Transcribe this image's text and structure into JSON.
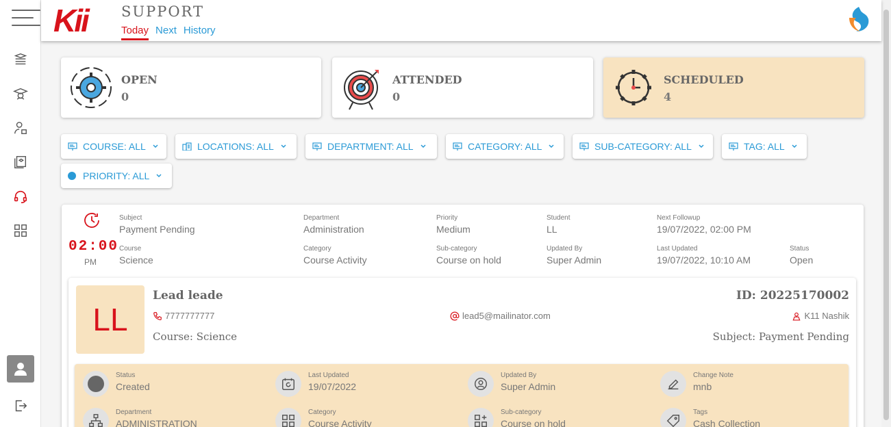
{
  "header": {
    "logo_text": "Kii",
    "title": "SUPPORT",
    "tabs": [
      {
        "label": "Today",
        "active": true
      },
      {
        "label": "Next",
        "active": false
      },
      {
        "label": "History",
        "active": false
      }
    ]
  },
  "sidebar": {
    "icons": [
      "courses-icon",
      "graduation-icon",
      "user-lock-icon",
      "library-icon",
      "headset-icon",
      "dashboard-icon"
    ],
    "active": "headset-icon",
    "profile_icon": "user-icon",
    "logout_icon": "logout-icon"
  },
  "summary": [
    {
      "label": "OPEN",
      "value": "0",
      "icon": "gear-cycle-icon"
    },
    {
      "label": "ATTENDED",
      "value": "0",
      "icon": "target-icon"
    },
    {
      "label": "SCHEDULED",
      "value": "4",
      "icon": "clock-gear-icon"
    }
  ],
  "filters": [
    {
      "label": "COURSE: ALL",
      "icon": "presentation-icon"
    },
    {
      "label": "LOCATIONS: ALL",
      "icon": "building-icon"
    },
    {
      "label": "DEPARTMENT: ALL",
      "icon": "presentation-icon"
    },
    {
      "label": "CATEGORY: ALL",
      "icon": "presentation-icon"
    },
    {
      "label": "SUB-CATEGORY: ALL",
      "icon": "presentation-icon"
    },
    {
      "label": "TAG: ALL",
      "icon": "presentation-icon"
    },
    {
      "label": "PRIORITY: ALL",
      "icon": "dot-icon"
    }
  ],
  "ticket": {
    "time": "02:00",
    "ampm": "PM",
    "fields": [
      {
        "label": "Subject",
        "value": "Payment Pending"
      },
      {
        "label": "Department",
        "value": "Administration"
      },
      {
        "label": "Priority",
        "value": "Medium"
      },
      {
        "label": "Student",
        "value": "LL"
      },
      {
        "label": "Next Followup",
        "value": "19/07/2022, 02:00 PM"
      },
      {
        "label": "Course",
        "value": "Science"
      },
      {
        "label": "Category",
        "value": "Course Activity"
      },
      {
        "label": "Sub-category",
        "value": "Course on hold"
      },
      {
        "label": "Updated By",
        "value": "Super Admin"
      },
      {
        "label": "Last Updated",
        "value": "19/07/2022, 10:10 AM"
      },
      {
        "label": "Status",
        "value": "Open"
      }
    ]
  },
  "lead": {
    "initials": "LL",
    "name": "Lead leade",
    "id": "ID: 20225170002",
    "phone": "7777777777",
    "email": "lead5@mailinator.com",
    "location": "K11 Nashik",
    "course": "Course: Science",
    "subject": "Subject: Payment Pending"
  },
  "details": [
    {
      "label": "Status",
      "value": "Created",
      "icon": "status-dot-icon"
    },
    {
      "label": "Last Updated",
      "value": "19/07/2022",
      "icon": "calendar-refresh-icon"
    },
    {
      "label": "Updated By",
      "value": "Super Admin",
      "icon": "user-update-icon"
    },
    {
      "label": "Change Note",
      "value": "mnb",
      "icon": "note-edit-icon"
    },
    {
      "label": "Department",
      "value": "ADMINISTRATION",
      "icon": "org-chart-icon"
    },
    {
      "label": "Category",
      "value": "Course Activity",
      "icon": "grid-icon"
    },
    {
      "label": "Sub-category",
      "value": "Course on hold",
      "icon": "grid-add-icon"
    },
    {
      "label": "Tags",
      "value": "Cash Collection",
      "icon": "tag-icon"
    }
  ],
  "colors": {
    "accent_red": "#d8131b",
    "link_blue": "#2a9ad6",
    "highlight": "#f8e3c0"
  }
}
